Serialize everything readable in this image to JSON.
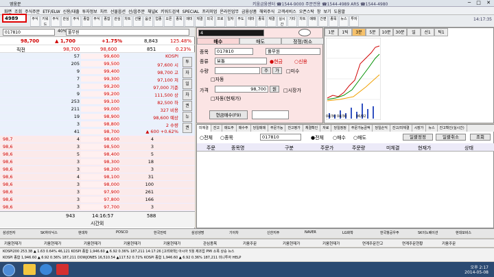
{
  "window": {
    "title": "영웅문",
    "phones": "키움금융센터 ☎1544-9000  주문전용 ☎1544-4989 ARS ☎1544-4980"
  },
  "menu": {
    "items": [
      "화면",
      "조회",
      "주식주문",
      "ETF/ELW",
      "신용/대출",
      "투자정보",
      "차트",
      "선물옵션",
      "선/옵주문",
      "채널K",
      "키워드검색",
      "SPECIAL",
      "프리미엄",
      "온라인업무",
      "금융상품",
      "해외주식",
      "고객서비스",
      "오픈스탁",
      "창",
      "보기",
      "도움말"
    ]
  },
  "toolbar": {
    "screen_code": "4989",
    "buttons": [
      "주식",
      "키워드",
      "주식",
      "관심",
      "주식",
      "종합",
      "주식",
      "종합",
      "관심",
      "차트",
      "선물",
      "옵션",
      "업종",
      "오픈",
      "종목",
      "매미",
      "체결",
      "외국",
      "프로",
      "일자",
      "주도",
      "테마",
      "종목",
      "체결",
      "실시간",
      "기타",
      "차트",
      "매매",
      "간편",
      "종목",
      "뉴스",
      "투자"
    ],
    "clock": "14:17:35"
  },
  "left_panel": {
    "code": "017810",
    "pct_badge": "40%",
    "name": "풀무원",
    "current_price": "98,700",
    "change": "▲ 1,700",
    "change_pct": "+1.75%",
    "volume": "8,843",
    "turnover_pct": "125.48%",
    "row2_label": "직전",
    "row2_price": "98,700",
    "row2_price2": "98,600",
    "row2_volume": "851",
    "row2_pct": "0.23%",
    "asks": [
      {
        "qty": "57",
        "price": "99,600",
        "info": "KOSPI"
      },
      {
        "qty": "205",
        "price": "99,500",
        "info": "97,600 시"
      },
      {
        "qty": "9",
        "price": "99,400",
        "info": "98,700 고"
      },
      {
        "qty": "7",
        "price": "99,300",
        "info": "97,100 저"
      },
      {
        "qty": "3",
        "price": "99,200",
        "info": "97,000 기준"
      },
      {
        "qty": "9",
        "price": "99,200",
        "info": "111,500 상"
      },
      {
        "qty": "253",
        "price": "99,100",
        "info": "82,500 하"
      },
      {
        "qty": "211",
        "price": "99,000",
        "info": "327 비용"
      },
      {
        "qty": "19",
        "price": "98,900",
        "info": "98,600 예상"
      },
      {
        "qty": "3",
        "price": "98,800",
        "info": "2 수량"
      },
      {
        "qty": "41",
        "price": "98,700",
        "info": "▲ 600   +0.62%"
      }
    ],
    "bids": [
      {
        "qty": "4",
        "price": "98,600",
        "info": "4"
      },
      {
        "qty": "3",
        "price": "98,500",
        "info": "3"
      },
      {
        "qty": "5",
        "price": "98,400",
        "info": "5"
      },
      {
        "qty": "3",
        "price": "98,300",
        "info": "18"
      },
      {
        "qty": "3",
        "price": "98,200",
        "info": "3"
      },
      {
        "qty": "4",
        "price": "98,100",
        "info": "31"
      },
      {
        "qty": "3",
        "price": "98,000",
        "info": "100"
      },
      {
        "qty": "3",
        "price": "97,900",
        "info": "261"
      },
      {
        "qty": "3",
        "price": "97,800",
        "info": "166"
      },
      {
        "qty": "3",
        "price": "97,700",
        "info": "3"
      }
    ],
    "bid_tags": [
      "98,7",
      "98,6",
      "98,6",
      "98,6",
      "98,6",
      "98,6",
      "98,6",
      "98,6",
      "98,6",
      "98,6"
    ],
    "footer": {
      "left": "943",
      "time": "14:16:57",
      "right": "588",
      "label": "시간외"
    },
    "side_buttons": [
      "투",
      "자",
      "일",
      "차",
      "권",
      "뉴",
      "권"
    ]
  },
  "order_panel": {
    "title_code": "4",
    "tabs": [
      "매수",
      "매도",
      "정정/취소"
    ],
    "labels": {
      "code": "종목",
      "type": "종류",
      "qty": "수량",
      "price": "가격"
    },
    "code": "017810",
    "name": "풀무원",
    "order_type": "보통",
    "cash": "●현금",
    "credit": "○신용",
    "qty_btn": "주",
    "sep_btn": "가",
    "no_qty": "□미수",
    "auto_label": "□자동",
    "price": "98,700",
    "price_unit": "원",
    "market_label": "□시장가",
    "auto2_label": "□자동(현재가)",
    "submit": "현금매수(F9)"
  },
  "chart": {
    "tabs": [
      "1분",
      "1틱",
      "3분",
      "5분",
      "10분",
      "30분",
      "일",
      "선1",
      "틱1"
    ],
    "active_tab": "3분",
    "x_labels": [
      "04/30 04/30",
      "06/02"
    ]
  },
  "orders": {
    "tabs": [
      "미체결",
      "잔고",
      "매도주",
      "매수주",
      "당일매매",
      "주문가능",
      "잔고평가",
      "체결확인",
      "자료",
      "당일정정",
      "주문가능금액",
      "당일손익",
      "잔고/미체결",
      "시장가",
      "뉴스",
      "잔고확인(실시간)"
    ],
    "filter_all": "○전체",
    "filter_code": "○종목",
    "code": "017810",
    "filter_all2": "●전체",
    "filter_buy": "○매수",
    "filter_sell": "○매도",
    "btn_modify": "일괄정정",
    "btn_cancel": "일괄취소",
    "btn_query": "조회",
    "columns": [
      "주문",
      "종목명",
      "구분",
      "주문가",
      "주문량",
      "미체결",
      "현재가",
      "상태"
    ]
  },
  "ticker": [
    "삼성전자",
    "SK하이닉스",
    "현대차",
    "POSCO",
    "한국전력",
    "삼성생명",
    "기아차",
    "신한지주",
    "NAVER",
    "LG화학",
    "한국항공우주",
    "SK이노베이션",
    "현대모비스"
  ],
  "tasks": [
    "키움현재가",
    "키움현재가",
    "키움현재가",
    "키움현재가",
    "키움현재가",
    "관심종목",
    "키움주문",
    "키움현재가",
    "키움현재가",
    "연계주문잔고",
    "연계주문현황",
    "키움주문"
  ],
  "status": {
    "line1": "KOSPI200   253.38  ▲ 1.63  0.64%   46,121        KOSPI 종합  1,946.60  ▲ 6.92  0.36%  187,211     14:17:26 [고려화학] 아시아 5월 제조업 PMI 소폭 상승   뉴스",
    "line2": "KOSPI 종합   1,946.60  ▲ 6.92  0.36%  187,211      DOWJONES  16,510.54  ▲117.52  0.72%      KOSPI 종합  1,946.60 ▲ 6.92  0.36%   187,211   미니투자 HELP"
  },
  "taskbar": {
    "time": "오후 2:17",
    "date": "2014-05-08"
  }
}
